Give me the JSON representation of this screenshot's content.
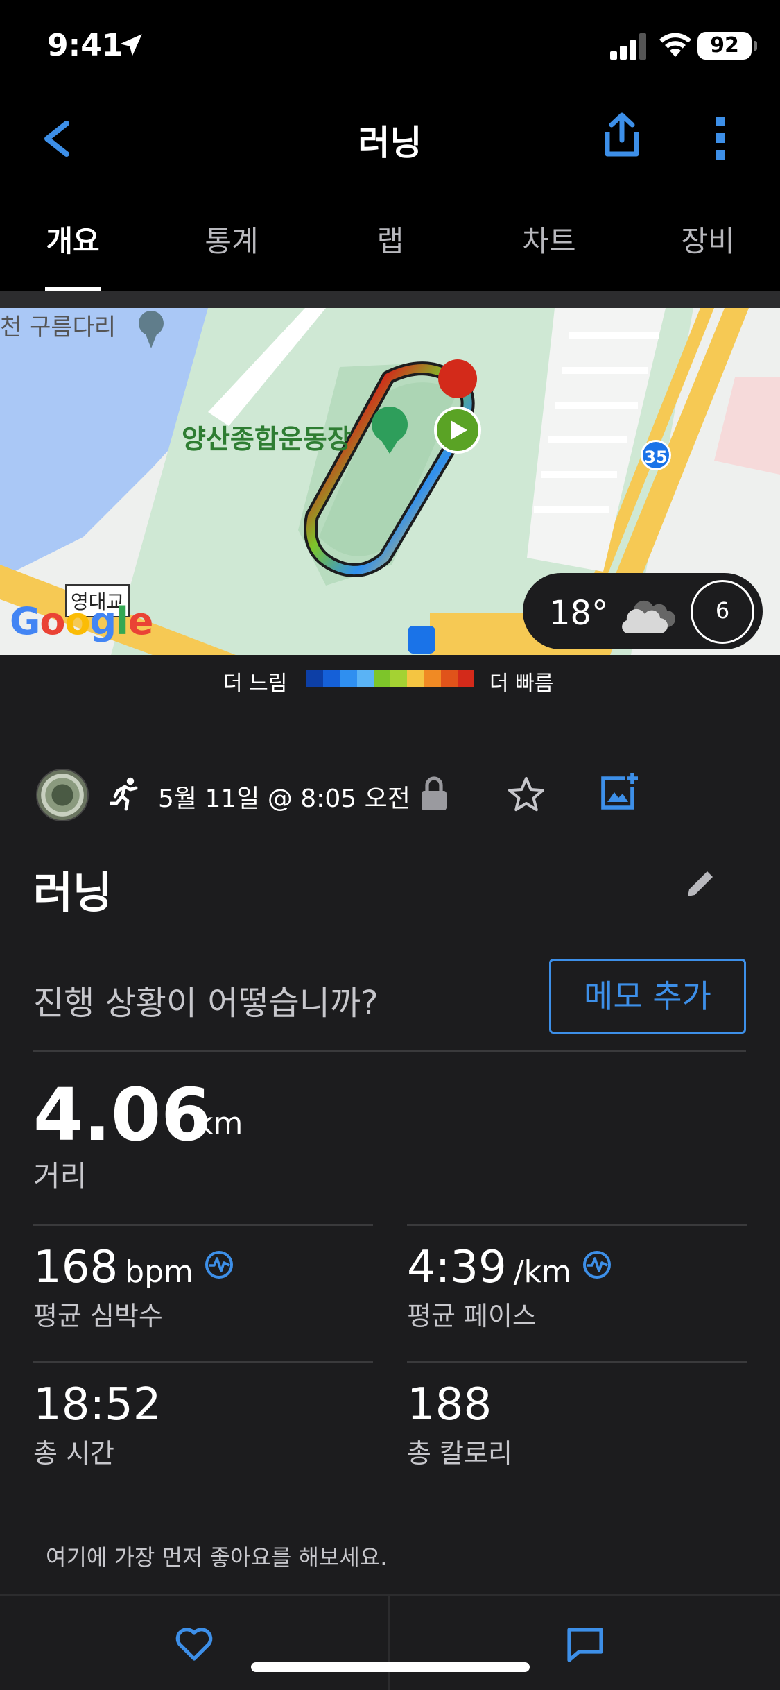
{
  "status_bar": {
    "time": "9:41",
    "battery": "92"
  },
  "nav": {
    "title": "러닝"
  },
  "tabs": [
    {
      "label": "개요",
      "active": true
    },
    {
      "label": "통계",
      "active": false
    },
    {
      "label": "랩",
      "active": false
    },
    {
      "label": "차트",
      "active": false
    },
    {
      "label": "장비",
      "active": false
    }
  ],
  "map": {
    "labels": {
      "stadium": "양산종합운동장",
      "bridge": "천 구름다리",
      "school": "영대교",
      "route_number": "35"
    },
    "attribution": "Google",
    "weather": {
      "temperature": "18°",
      "wind_speed": "6"
    }
  },
  "legend": {
    "slow_label": "더 느림",
    "fast_label": "더 빠름",
    "colors": [
      "#0d3fa6",
      "#1560d8",
      "#2f8ff0",
      "#5ab3f5",
      "#7dc52a",
      "#a4d233",
      "#f4c542",
      "#f08a24",
      "#e0531a",
      "#d32a1a"
    ]
  },
  "activity": {
    "date": "5월 11일 @ 8:05 오전",
    "title": "러닝",
    "prompt": "진행 상황이 어떻습니까?",
    "memo_button": "메모 추가"
  },
  "stats": {
    "distance": {
      "value": "4.06",
      "unit": "km",
      "label": "거리"
    },
    "avg_hr": {
      "value": "168",
      "unit": "bpm",
      "label": "평균 심박수"
    },
    "avg_pace": {
      "value": "4:39",
      "unit": "/km",
      "label": "평균 페이스"
    },
    "total_time": {
      "value": "18:52",
      "label": "총 시간"
    },
    "total_calories": {
      "value": "188",
      "label": "총 칼로리"
    }
  },
  "social": {
    "like_prompt": "여기에 가장 먼저 좋아요를 해보세요."
  },
  "colors": {
    "accent": "#3d8fe8",
    "background": "#1c1c1e",
    "header": "#000000"
  }
}
